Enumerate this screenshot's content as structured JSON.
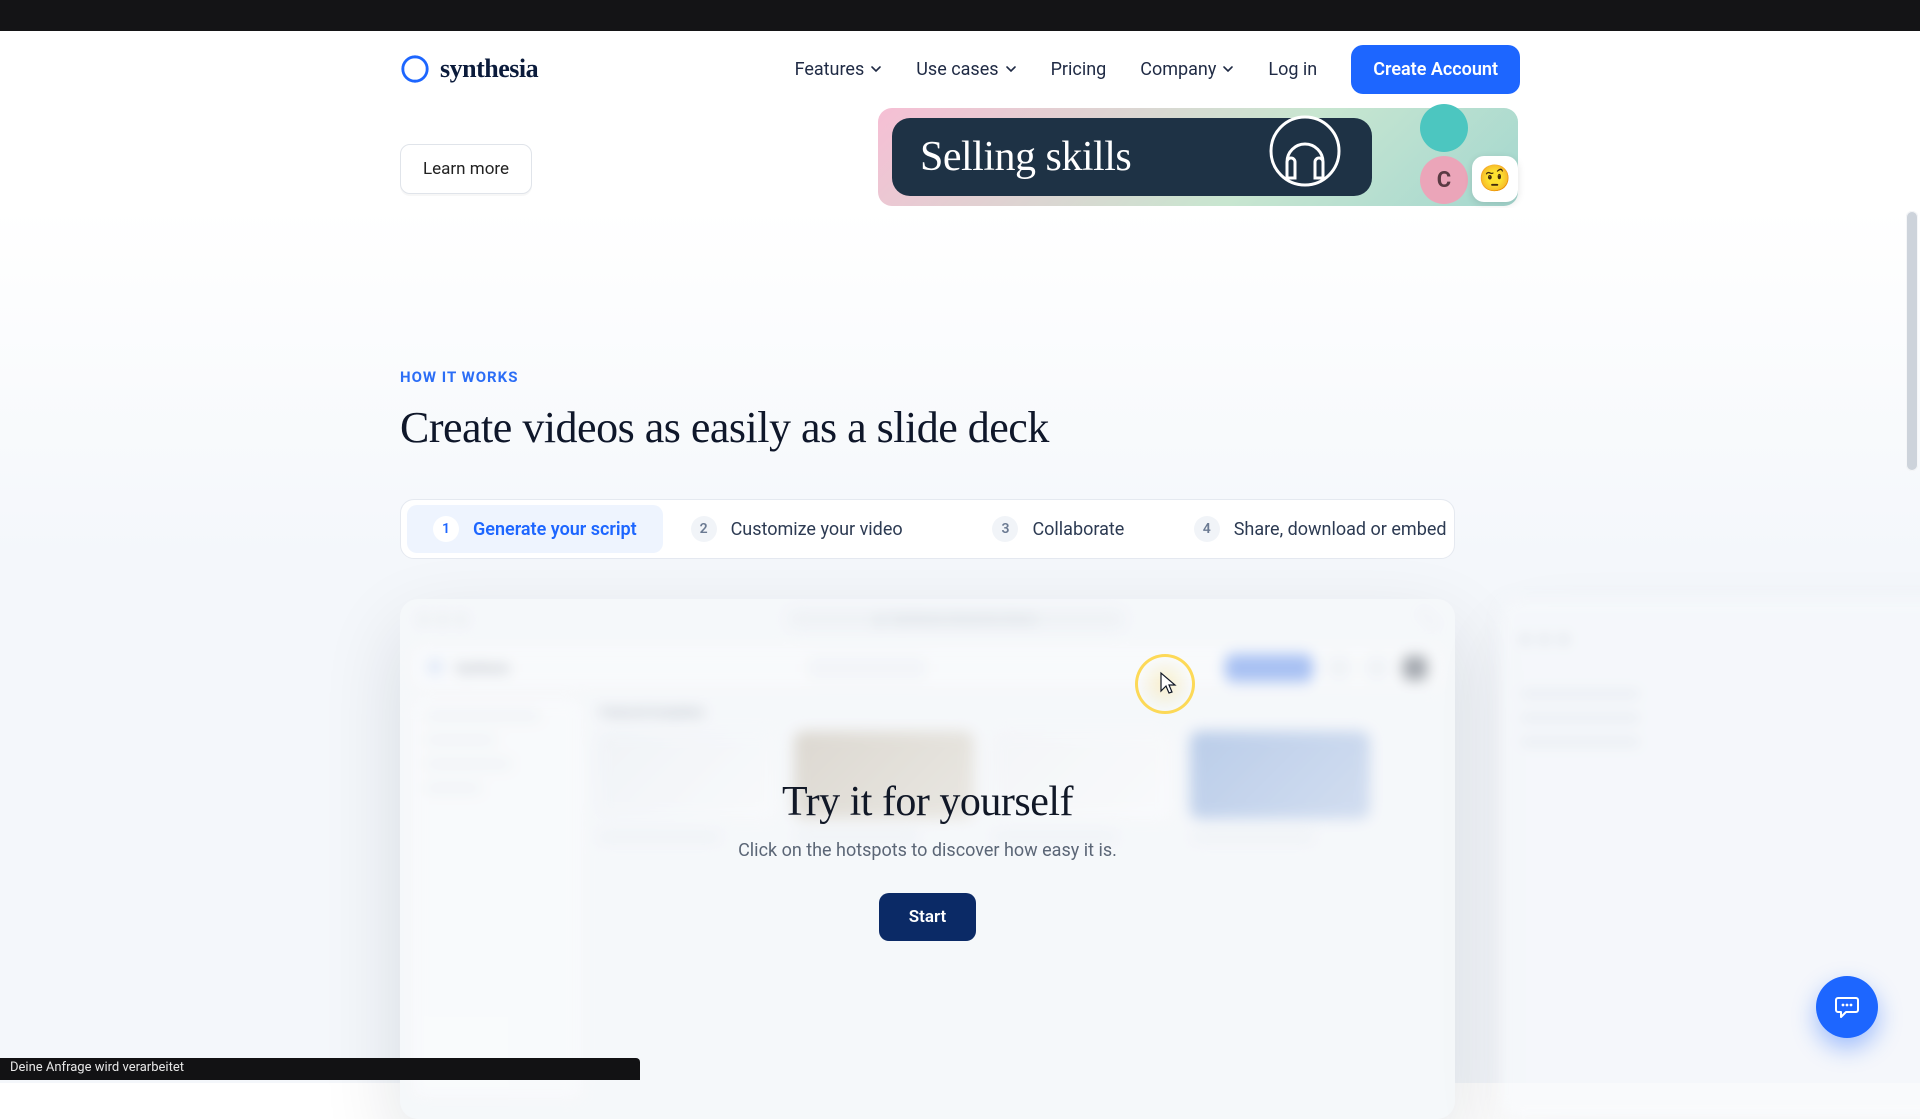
{
  "brand": {
    "name": "synthesia"
  },
  "nav": {
    "features": "Features",
    "use_cases": "Use cases",
    "pricing": "Pricing",
    "company": "Company",
    "login": "Log in",
    "cta": "Create Account"
  },
  "hero": {
    "learn_more": "Learn more",
    "sell_card": "Selling skills",
    "avatar_c": "C",
    "emoji": "🤨"
  },
  "section": {
    "eyebrow": "HOW IT WORKS",
    "title": "Create videos as easily as a slide deck"
  },
  "tabs": [
    {
      "num": "1",
      "label": "Generate your script"
    },
    {
      "num": "2",
      "label": "Customize your video"
    },
    {
      "num": "3",
      "label": "Collaborate"
    },
    {
      "num": "4",
      "label": "Share, download or embed"
    }
  ],
  "demo": {
    "address": "Synthesia Interactive Demo",
    "crumb": "Synthesia",
    "pane_head": "Featured templates",
    "overlay_title": "Try it for yourself",
    "overlay_sub": "Click on the hotspots to discover how easy it is.",
    "start": "Start"
  },
  "status": "Deine Anfrage wird verarbeitet"
}
